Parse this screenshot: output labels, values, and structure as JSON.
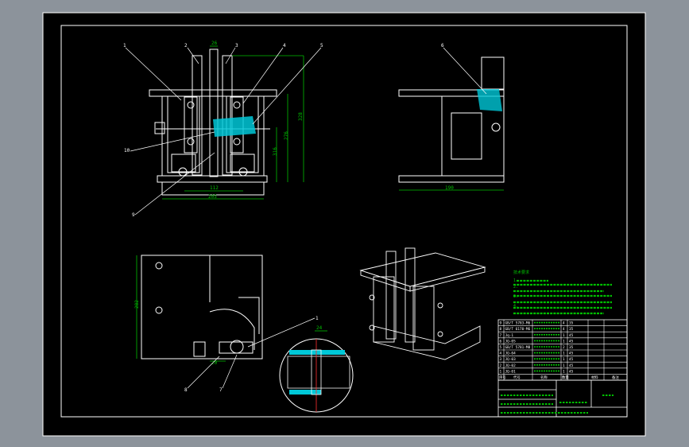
{
  "viewport": {
    "background": "#8c939b",
    "sheet_color": "#000000",
    "line_color": "#ffffff",
    "dim_color": "#00c000",
    "section_color": "#00c8d8"
  },
  "front_view": {
    "balloons": [
      "1",
      "2",
      "3",
      "4",
      "5",
      "10",
      "9"
    ],
    "dims": {
      "top_width": "26",
      "height_total": "328",
      "height_mid": "276",
      "height_low": "316",
      "inner_width": "112",
      "base_width": "205"
    }
  },
  "side_view": {
    "balloons": [
      "6"
    ],
    "dims": {
      "base_width": "190"
    }
  },
  "bottom_view": {
    "balloons": [
      "1",
      "8",
      "7"
    ],
    "dims": {
      "height": "282",
      "small": "20",
      "detail": "24"
    }
  },
  "notes": {
    "title": "技术要求",
    "lines": [
      "1.",
      "2.",
      "3.",
      "4."
    ]
  },
  "bom": {
    "rows": [
      {
        "no": "9",
        "code": "GB/T 5783-M6",
        "name": "",
        "qty": "4",
        "mat": "35"
      },
      {
        "no": "8",
        "code": "GB/T 6170-M6",
        "name": "",
        "qty": "4",
        "mat": "35"
      },
      {
        "no": "7",
        "code": "Jq-1",
        "name": "",
        "qty": "1",
        "mat": "45"
      },
      {
        "no": "6",
        "code": "JQ-05",
        "name": "",
        "qty": "1",
        "mat": "45"
      },
      {
        "no": "5",
        "code": "GB/T 5781-M8",
        "name": "",
        "qty": "2",
        "mat": "35"
      },
      {
        "no": "4",
        "code": "JQ-04",
        "name": "",
        "qty": "1",
        "mat": "45"
      },
      {
        "no": "3",
        "code": "JQ-03",
        "name": "",
        "qty": "1",
        "mat": "45"
      },
      {
        "no": "2",
        "code": "JQ-02",
        "name": "",
        "qty": "1",
        "mat": "45"
      },
      {
        "no": "1",
        "code": "JQ-01",
        "name": "",
        "qty": "1",
        "mat": "45"
      }
    ],
    "header": [
      "序号",
      "代号",
      "名称",
      "数量",
      "材料",
      "备注"
    ]
  }
}
